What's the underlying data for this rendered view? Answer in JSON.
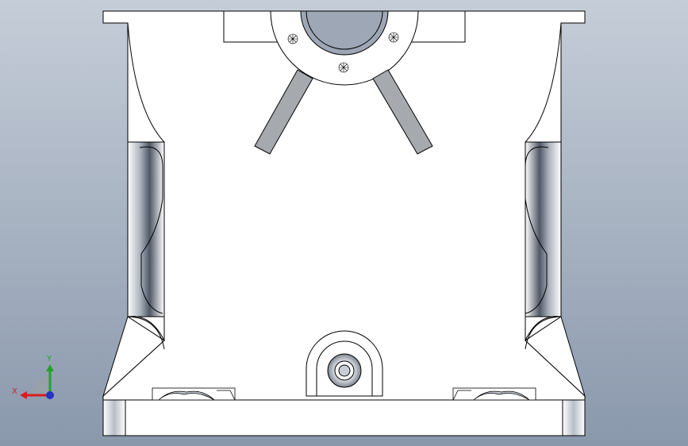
{
  "viewport": {
    "background_top": "#c5cdd8",
    "background_bottom": "#8a98ac"
  },
  "model": {
    "face_color": "#ffffff",
    "edge_color": "#000000",
    "slot_color": "#a6aaae",
    "bore_color": "#9da7b5"
  },
  "triad": {
    "x_label": "X",
    "y_label": "Y",
    "x_color": "#d42020",
    "y_color": "#22a22a",
    "z_color": "#2533c8"
  }
}
